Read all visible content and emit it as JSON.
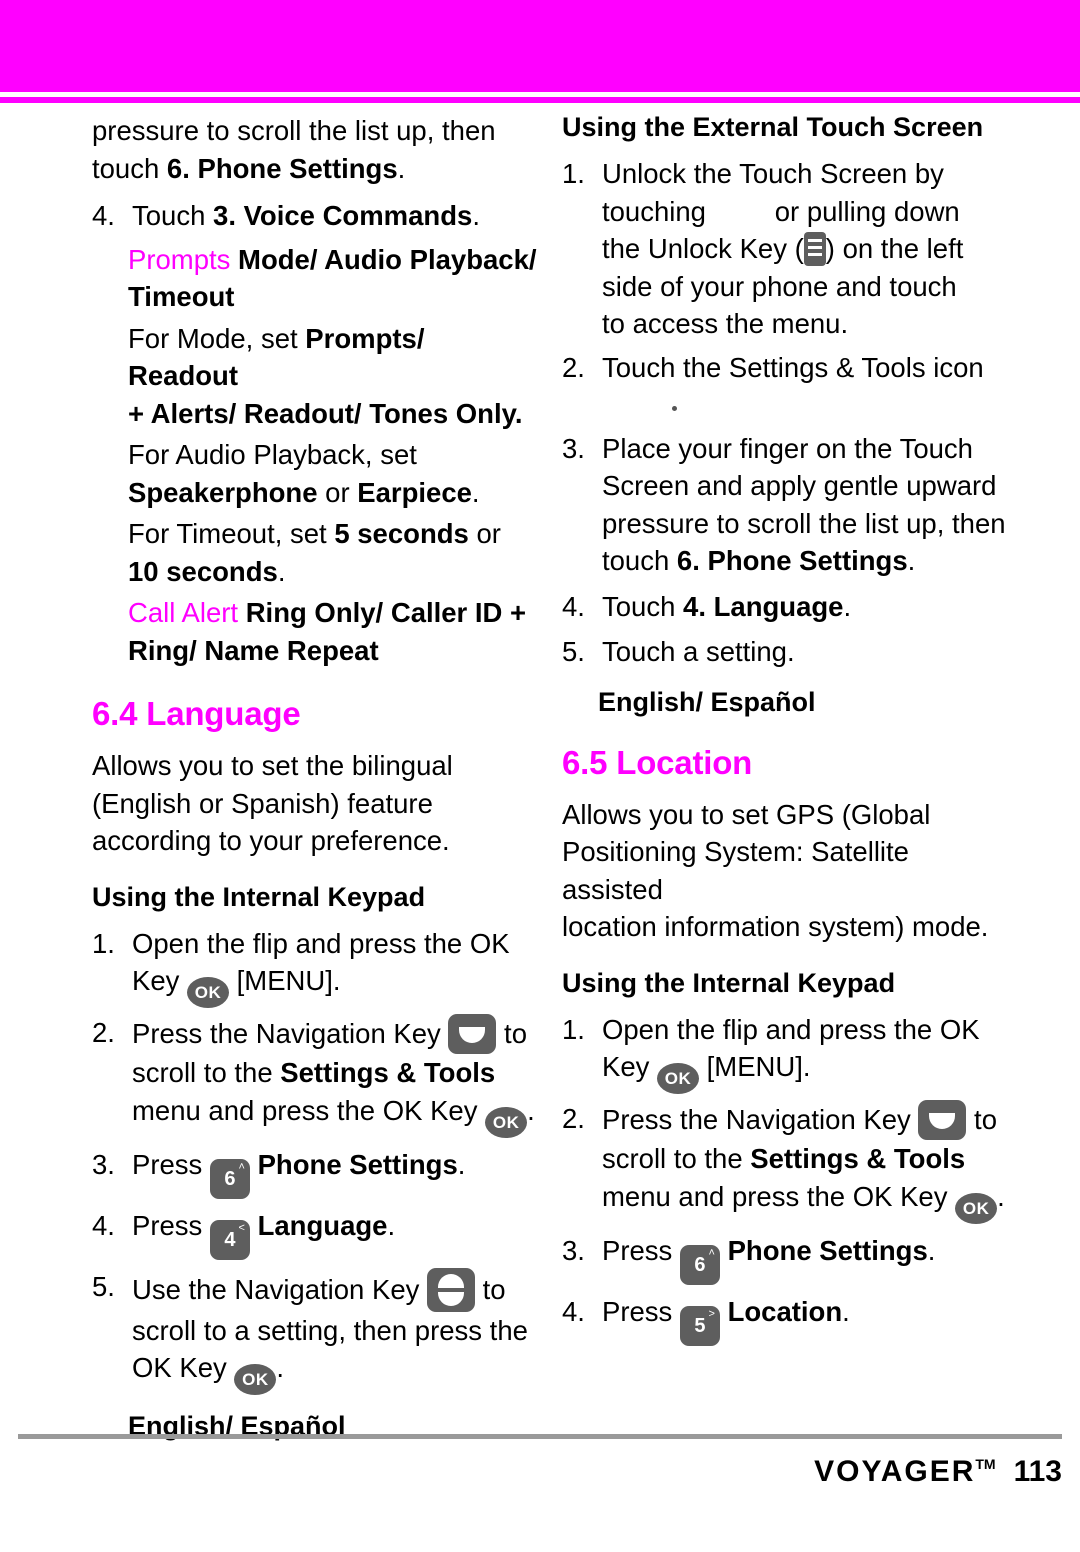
{
  "page": {
    "number": "113",
    "brand": "VOYAGER",
    "brand_tm": "TM"
  },
  "left_column": {
    "cont_para_1_a": "pressure to scroll the list up, then",
    "cont_para_1_b": "touch ",
    "cont_para_1_bold": "6. Phone Settings",
    "cont_para_1_c": ".",
    "step4_num": "4.",
    "step4_text": "Touch ",
    "step4_bold": "3. Voice Commands",
    "step4_end": ".",
    "prompts_label": "Prompts",
    "prompts_value_line1": "Mode/ Audio Playback/",
    "prompts_value_line2": "Timeout",
    "for_mode_plain": "For Mode, set ",
    "for_mode_bold1": "Prompts/ Readout",
    "for_mode_bold2": "+ Alerts/ Readout/ Tones Only",
    "for_mode_end": ".",
    "for_audio_plain": "For Audio Playback, set",
    "for_audio_bold1": "Speakerphone",
    "for_audio_mid": " or ",
    "for_audio_bold2": "Earpiece",
    "for_audio_end": ".",
    "for_timeout_plain": "For Timeout, set ",
    "for_timeout_bold1": "5 seconds",
    "for_timeout_mid": " or",
    "for_timeout_bold2": "10 seconds",
    "for_timeout_end": ".",
    "call_alert_label": "Call Alert",
    "call_alert_value_line1": "Ring Only/ Caller ID +",
    "call_alert_value_line2": "Ring/ Name Repeat",
    "section_64": "6.4 Language",
    "lang_intro_line1": "Allows you to set the bilingual",
    "lang_intro_line2": "(English or Spanish) feature",
    "lang_intro_line3": "according to your preference.",
    "internal_keypad_head": "Using the Internal Keypad",
    "steps": [
      {
        "num": "1.",
        "line1": "Open the flip and press the OK",
        "line2_pre": "Key ",
        "key": "OK",
        "line2_post": " [MENU]."
      },
      {
        "num": "2.",
        "line1_pre": "Press the Navigation Key ",
        "line1_post": " to",
        "line2_pre": "scroll to the ",
        "line2_bold": "Settings & Tools",
        "line3_pre": "menu and press the OK Key ",
        "line3_post": "."
      },
      {
        "num": "3.",
        "text_pre": "Press ",
        "key_digit": "6",
        "key_sup": "˄",
        "text_bold": "Phone Settings",
        "text_post": "."
      },
      {
        "num": "4.",
        "text_pre": "Press ",
        "key_digit": "4",
        "key_sup": "˂",
        "text_bold": "Language",
        "text_post": "."
      },
      {
        "num": "5.",
        "line1_pre": "Use the Navigation Key ",
        "line1_post": " to",
        "line2": "scroll to a setting, then press the",
        "line3_pre": "OK Key ",
        "line3_post": "."
      }
    ],
    "english_espanol": "English/ Español"
  },
  "right_column": {
    "external_touch_head": "Using the External Touch Screen",
    "steps": [
      {
        "num": "1.",
        "line1": "Unlock the Touch Screen by",
        "line2_pre": "touching",
        "line2_post": "or pulling down",
        "line3_pre": "the Unlock Key (",
        "line3_post": ") on the left",
        "line4": "side of your phone and touch",
        "line5": "to access the menu."
      },
      {
        "num": "2.",
        "line1": "Touch the Settings & Tools icon"
      },
      {
        "num": "3.",
        "line1": "Place your finger on the Touch",
        "line2": "Screen and apply gentle upward",
        "line3": "pressure to scroll the list up, then",
        "line4_pre": "touch ",
        "line4_bold": "6. Phone Settings",
        "line4_post": "."
      },
      {
        "num": "4.",
        "line1_pre": "Touch ",
        "line1_bold": "4. Language",
        "line1_post": "."
      },
      {
        "num": "5.",
        "line1": "Touch a setting."
      }
    ],
    "english_espanol": "English/ Español",
    "section_65": "6.5 Location",
    "loc_intro_line1": "Allows you to set GPS (Global",
    "loc_intro_line2": "Positioning System: Satellite assisted",
    "loc_intro_line3": "location information system) mode.",
    "internal_keypad_head": "Using the Internal Keypad",
    "keypad_steps": [
      {
        "num": "1.",
        "line1": "Open the flip and press the OK",
        "line2_pre": "Key ",
        "key": "OK",
        "line2_post": " [MENU]."
      },
      {
        "num": "2.",
        "line1_pre": "Press the Navigation Key ",
        "line1_post": " to",
        "line2_pre": "scroll to the ",
        "line2_bold": "Settings & Tools",
        "line3_pre": "menu and press the OK Key ",
        "line3_post": "."
      },
      {
        "num": "3.",
        "text_pre": "Press ",
        "key_digit": "6",
        "key_sup": "˄",
        "text_bold": "Phone Settings",
        "text_post": "."
      },
      {
        "num": "4.",
        "text_pre": "Press ",
        "key_digit": "5",
        "key_sup": "˃",
        "text_bold": "Location",
        "text_post": "."
      }
    ]
  },
  "colors": {
    "accent": "#ff00ff",
    "key_gray": "#5e5e5e",
    "rule_gray": "#9a9a9a"
  }
}
